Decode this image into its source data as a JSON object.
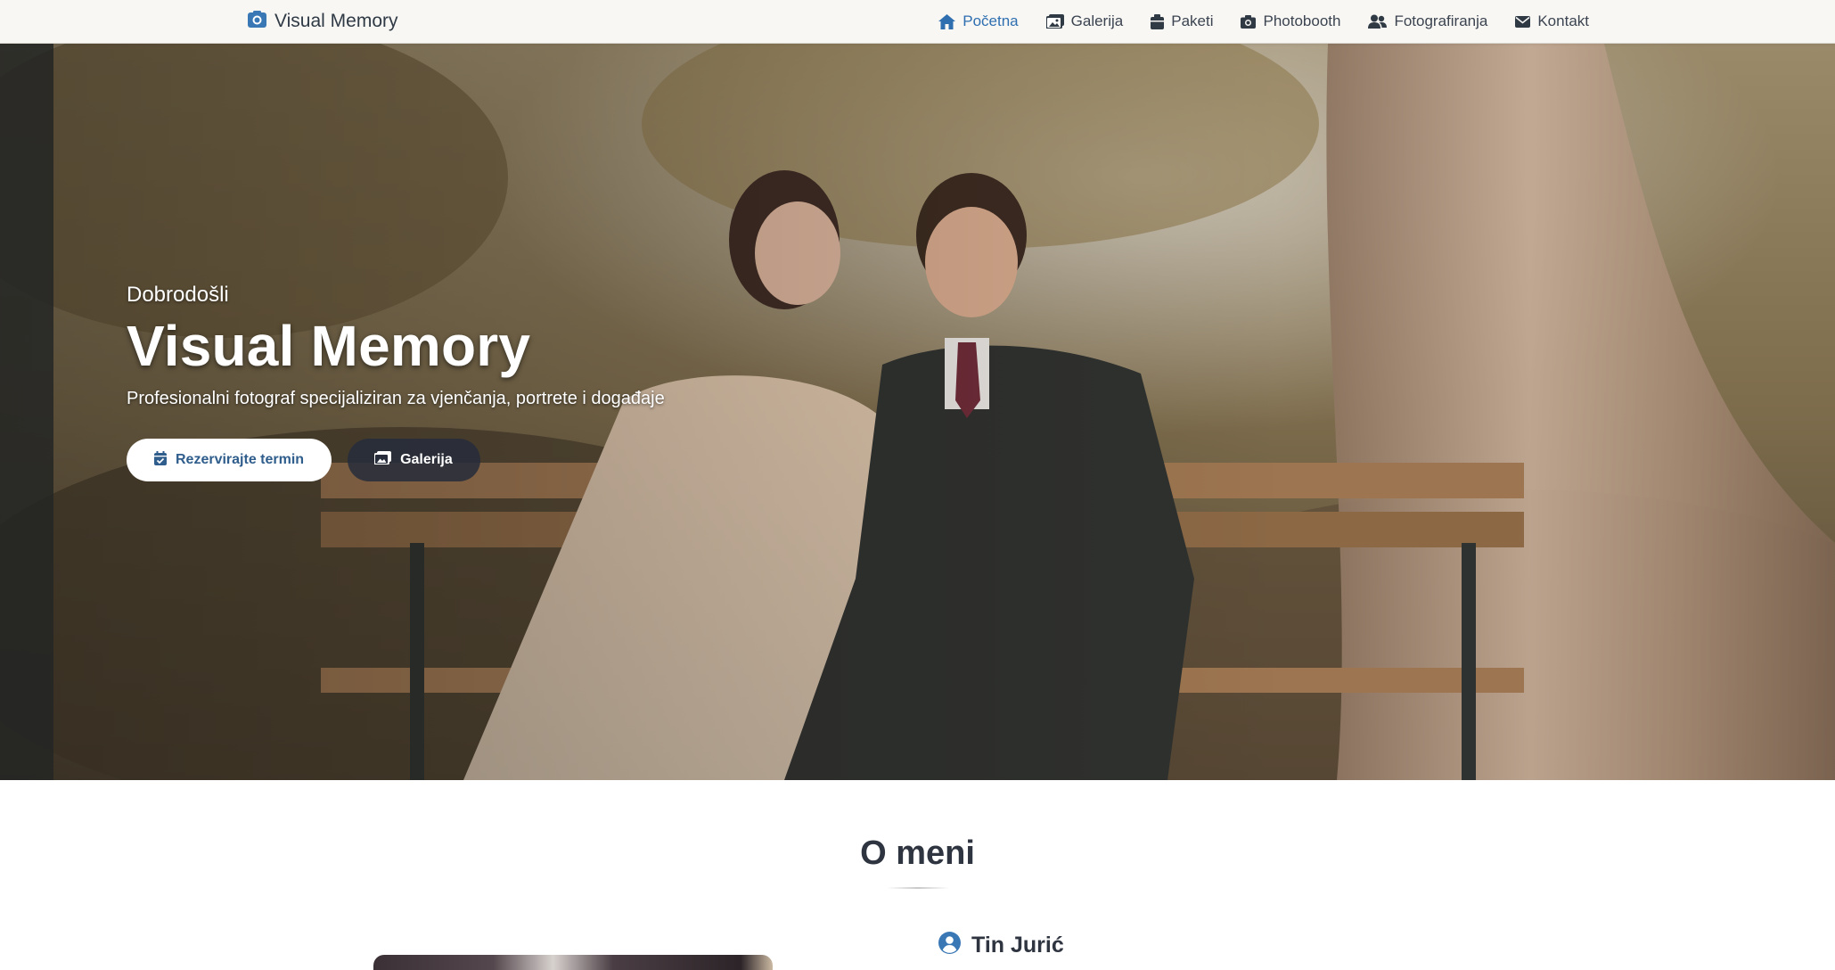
{
  "brand": {
    "name": "Visual Memory",
    "icon": "camera-icon"
  },
  "nav": {
    "items": [
      {
        "label": "Početna",
        "icon": "home-icon",
        "active": true
      },
      {
        "label": "Galerija",
        "icon": "images-icon",
        "active": false
      },
      {
        "label": "Paketi",
        "icon": "box-icon",
        "active": false
      },
      {
        "label": "Photobooth",
        "icon": "camera-icon",
        "active": false
      },
      {
        "label": "Fotografiranja",
        "icon": "users-icon",
        "active": false
      },
      {
        "label": "Kontakt",
        "icon": "envelope-icon",
        "active": false
      }
    ]
  },
  "hero": {
    "eyebrow": "Dobrodošli",
    "title": "Visual Memory",
    "subtitle": "Profesionalni fotograf specijaliziran za vjenčanja, portrete i događaje",
    "primary_button": "Rezervirajte termin",
    "secondary_button": "Galerija"
  },
  "about": {
    "title": "O meni",
    "name": "Tin Jurić"
  },
  "colors": {
    "accent": "#2f6fb0",
    "nav_text": "#3b4450",
    "primary_button_text": "#2f5d8c",
    "secondary_button_bg": "#262c3a"
  }
}
